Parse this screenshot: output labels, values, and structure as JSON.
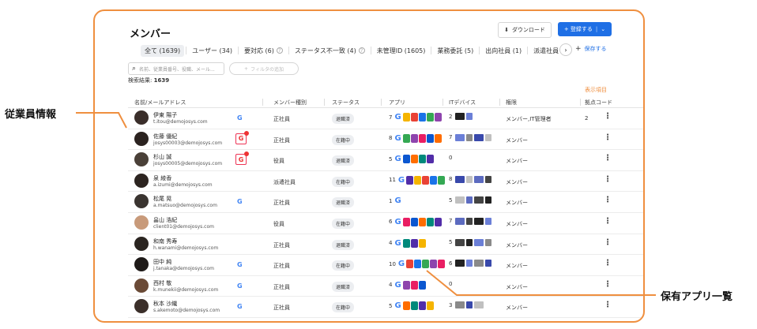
{
  "header": {
    "title": "メンバー",
    "download_label": "ダウンロード",
    "register_label": "+ 登録する"
  },
  "tabs": [
    {
      "label": "全て (1639)",
      "active": true,
      "help": false
    },
    {
      "label": "ユーザー (34)",
      "active": false,
      "help": false
    },
    {
      "label": "要対応 (6)",
      "active": false,
      "help": true
    },
    {
      "label": "ステータス不一致 (4)",
      "active": false,
      "help": true
    },
    {
      "label": "未管理ID (1605)",
      "active": false,
      "help": false
    },
    {
      "label": "業務委託 (5)",
      "active": false,
      "help": false
    },
    {
      "label": "出向社員 (1)",
      "active": false,
      "help": false
    },
    {
      "label": "派遣社員 (1)",
      "active": false,
      "help": false
    }
  ],
  "save_view_label": "保存する",
  "search": {
    "placeholder": "名前、従業員番号、役職、メール..."
  },
  "filter_label": "フィルタの追加",
  "result": {
    "label": "検索結果:",
    "count": "1639"
  },
  "display_items_label": "表示項目",
  "columns": {
    "name": "名前/メールアドレス",
    "member_type": "メンバー種別",
    "status": "ステータス",
    "apps": "アプリ",
    "devices": "ITデバイス",
    "role": "権限",
    "code": "拠点コード"
  },
  "rows": [
    {
      "name": "伊東 陽子",
      "email": "t.itou@demojosys.com",
      "google": "plain",
      "type": "正社員",
      "status": "退職済",
      "app_count": "7",
      "dev_count": "2",
      "role": "メンバー,IT管理者",
      "code": "2",
      "avatar": "#3a2e2a"
    },
    {
      "name": "佐藤 優紀",
      "email": "josys00003@demojosys.com",
      "google": "alert",
      "type": "正社員",
      "status": "在籍中",
      "app_count": "8",
      "dev_count": "7",
      "role": "メンバー",
      "code": "",
      "avatar": "#2b2320"
    },
    {
      "name": "杉山 誠",
      "email": "josys00005@demojosys.com",
      "google": "alert",
      "type": "役員",
      "status": "退職済",
      "app_count": "5",
      "dev_count": "0",
      "role": "メンバー",
      "code": "",
      "avatar": "#4a4038"
    },
    {
      "name": "泉 綾香",
      "email": "a.izumi@demojosys.com",
      "google": "none",
      "type": "派遣社員",
      "status": "在籍中",
      "app_count": "11",
      "dev_count": "8",
      "role": "メンバー",
      "code": "",
      "avatar": "#2c2420"
    },
    {
      "name": "松尾 晃",
      "email": "a.matsuo@demojosys.com",
      "google": "plain",
      "type": "正社員",
      "status": "退職済",
      "app_count": "1",
      "dev_count": "5",
      "role": "メンバー",
      "code": "",
      "avatar": "#3a3430"
    },
    {
      "name": "畠山 浩紀",
      "email": "client01@demojosys.com",
      "google": "none",
      "type": "役員",
      "status": "在籍中",
      "app_count": "6",
      "dev_count": "7",
      "role": "メンバー",
      "code": "",
      "avatar": "#c89a7a"
    },
    {
      "name": "和南 秀寿",
      "email": "h.wanami@demojosys.com",
      "google": "none",
      "type": "正社員",
      "status": "退職済",
      "app_count": "4",
      "dev_count": "5",
      "role": "メンバー",
      "code": "",
      "avatar": "#2a2420"
    },
    {
      "name": "田中 純",
      "email": "j.tanaka@demojosys.com",
      "google": "plain",
      "type": "正社員",
      "status": "在籍中",
      "app_count": "10",
      "dev_count": "6",
      "role": "メンバー",
      "code": "",
      "avatar": "#1e1a18"
    },
    {
      "name": "西村 敬",
      "email": "k.munekii@demojosys.com",
      "google": "plain",
      "type": "正社員",
      "status": "退職済",
      "app_count": "4",
      "dev_count": "0",
      "role": "メンバー",
      "code": "",
      "avatar": "#6a4a36"
    },
    {
      "name": "秋本 沙織",
      "email": "s.akemoto@demojosys.com",
      "google": "plain",
      "type": "正社員",
      "status": "在籍中",
      "app_count": "5",
      "dev_count": "3",
      "role": "メンバー",
      "code": "",
      "avatar": "#3b2f2a"
    }
  ],
  "callouts": {
    "employee_info": "従業員情報",
    "owned_apps": "保有アプリ一覧"
  },
  "colors": {
    "accent": "#ef8f3f",
    "primary": "#1f6fe5",
    "google": "#4285f4",
    "alert": "#e33333"
  }
}
